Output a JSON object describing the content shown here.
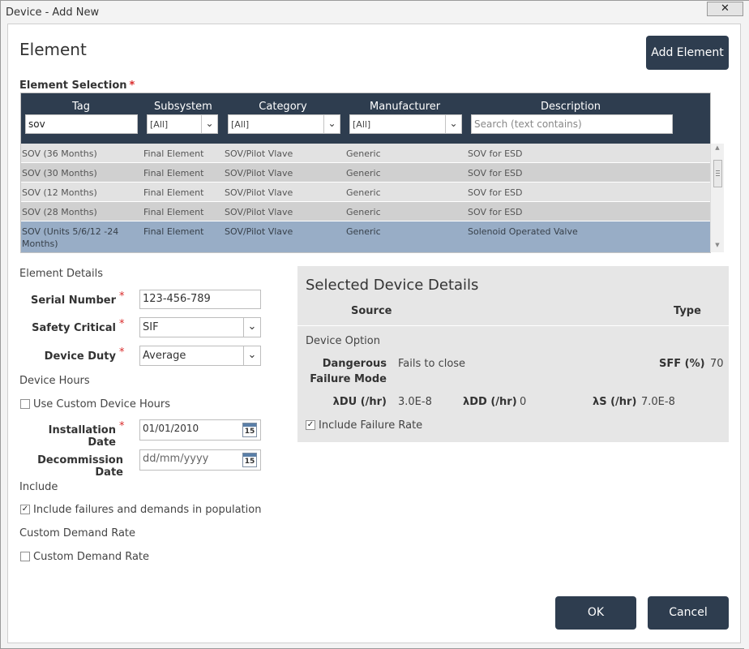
{
  "window": {
    "title": "Device - Add New",
    "close_label": "✕"
  },
  "header": {
    "title": "Element",
    "add_button": "Add Element"
  },
  "selection": {
    "label": "Element Selection",
    "required_mark": "*",
    "columns": {
      "tag": "Tag",
      "subsystem": "Subsystem",
      "category": "Category",
      "manufacturer": "Manufacturer",
      "description": "Description"
    },
    "filters": {
      "tag": "sov",
      "subsystem": "[All]",
      "category": "[All]",
      "manufacturer": "[All]",
      "description_placeholder": "Search (text contains)"
    },
    "rows": [
      {
        "tag": "SOV (36 Months)",
        "subsystem": "Final Element",
        "category": "SOV/Pilot Vlave",
        "manufacturer": "Generic",
        "description": "SOV for ESD"
      },
      {
        "tag": "SOV (30 Months)",
        "subsystem": "Final Element",
        "category": "SOV/Pilot Vlave",
        "manufacturer": "Generic",
        "description": "SOV for ESD"
      },
      {
        "tag": "SOV (12 Months)",
        "subsystem": "Final Element",
        "category": "SOV/Pilot Vlave",
        "manufacturer": "Generic",
        "description": "SOV for ESD"
      },
      {
        "tag": "SOV (28 Months)",
        "subsystem": "Final Element",
        "category": "SOV/Pilot Vlave",
        "manufacturer": "Generic",
        "description": "SOV for ESD"
      },
      {
        "tag_line1": "SOV (Units 5/6/12 -24",
        "tag_line2": "Months)",
        "subsystem": "Final Element",
        "category": "SOV/Pilot Vlave",
        "manufacturer": "Generic",
        "description": "Solenoid Operated Valve"
      }
    ]
  },
  "details": {
    "heading": "Element Details",
    "serial_label": "Serial Number",
    "serial_value": "123-456-789",
    "safety_label": "Safety Critical",
    "safety_value": "SIF",
    "duty_label": "Device Duty",
    "duty_value": "Average",
    "hours_heading": "Device Hours",
    "custom_hours_label": "Use Custom Device Hours",
    "install_label": "Installation Date",
    "install_value": "01/01/2010",
    "decom_label": "Decommission Date",
    "decom_placeholder": "dd/mm/yyyy",
    "calendar_day": "15",
    "include_heading": "Include",
    "include_label": "Include failures and demands in population",
    "demand_heading": "Custom Demand Rate",
    "demand_label": "Custom Demand Rate"
  },
  "selected": {
    "title": "Selected Device Details",
    "source_header": "Source",
    "type_header": "Type",
    "option_label": "Device Option",
    "dfm_label_line1": "Dangerous",
    "dfm_label_line2": "Failure Mode",
    "dfm_value": "Fails to close",
    "sff_label": "SFF (%)",
    "sff_value": "70",
    "ldu_label": "λDU (/hr)",
    "ldu_value": "3.0E-8",
    "ldd_label": "λDD (/hr)",
    "ldd_value": "0",
    "ls_label": "λS (/hr)",
    "ls_value": "7.0E-8",
    "include_rate_label": "Include Failure Rate"
  },
  "checkboxes": {
    "use_custom_hours": false,
    "include_failures": true,
    "custom_demand": false,
    "include_failure_rate": true
  },
  "footer": {
    "ok": "OK",
    "cancel": "Cancel"
  },
  "colors": {
    "accent_dark": "#2e3d4f",
    "selected_row": "#98adc6",
    "required": "#d92b2b"
  }
}
